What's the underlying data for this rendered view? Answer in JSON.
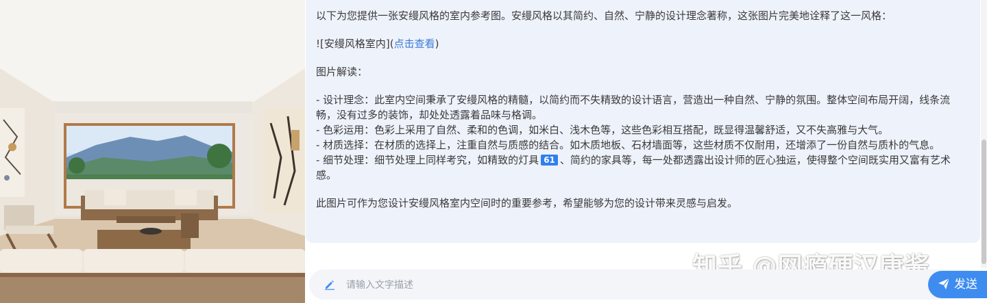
{
  "message": {
    "intro": "以下为您提供一张安缦风格的室内参考图。安缦风格以其简约、自然、宁静的设计理念著称，这张图片完美地诠释了这一风格：",
    "image_md_prefix": "![安缦风格室内](",
    "image_link_label": "点击查看",
    "image_md_suffix": ")",
    "heading": "图片解读：",
    "bullets": [
      "- 设计理念：此室内空间秉承了安缦风格的精髓，以简约而不失精致的设计语言，营造出一种自然、宁静的氛围。整体空间布局开阔，线条流畅，没有过多的装饰，却处处透露着品味与格调。",
      "- 色彩运用：色彩上采用了自然、柔和的色调，如米白、浅木色等，这些色彩相互搭配，既显得温馨舒适，又不失高雅与大气。",
      "- 材质选择：在材质的选择上，注重自然与质感的结合。如木质地板、石材墙面等，这些材质不仅耐用，还增添了一份自然与质朴的气息。"
    ],
    "bullet4_before": "- 细节处理：细节处理上同样考究，如精致的灯具",
    "bullet4_ref": "61",
    "bullet4_after": "、简约的家具等，每一处都透露出设计师的匠心独运，使得整个空间既实用又富有艺术感。",
    "closing": "此图片可作为您设计安缦风格室内空间时的重要参考，希望能够为您的设计带来灵感与启发。"
  },
  "watermark": "知乎 @网瘾硬汉康酱",
  "input": {
    "placeholder": "请输入文字描述",
    "value": ""
  },
  "send_button": {
    "label": "发送",
    "icon": "paper-plane-icon"
  },
  "colors": {
    "bubble_bg": "#eef2fb",
    "accent": "#3f8cf0",
    "link": "#3a7bd5"
  }
}
